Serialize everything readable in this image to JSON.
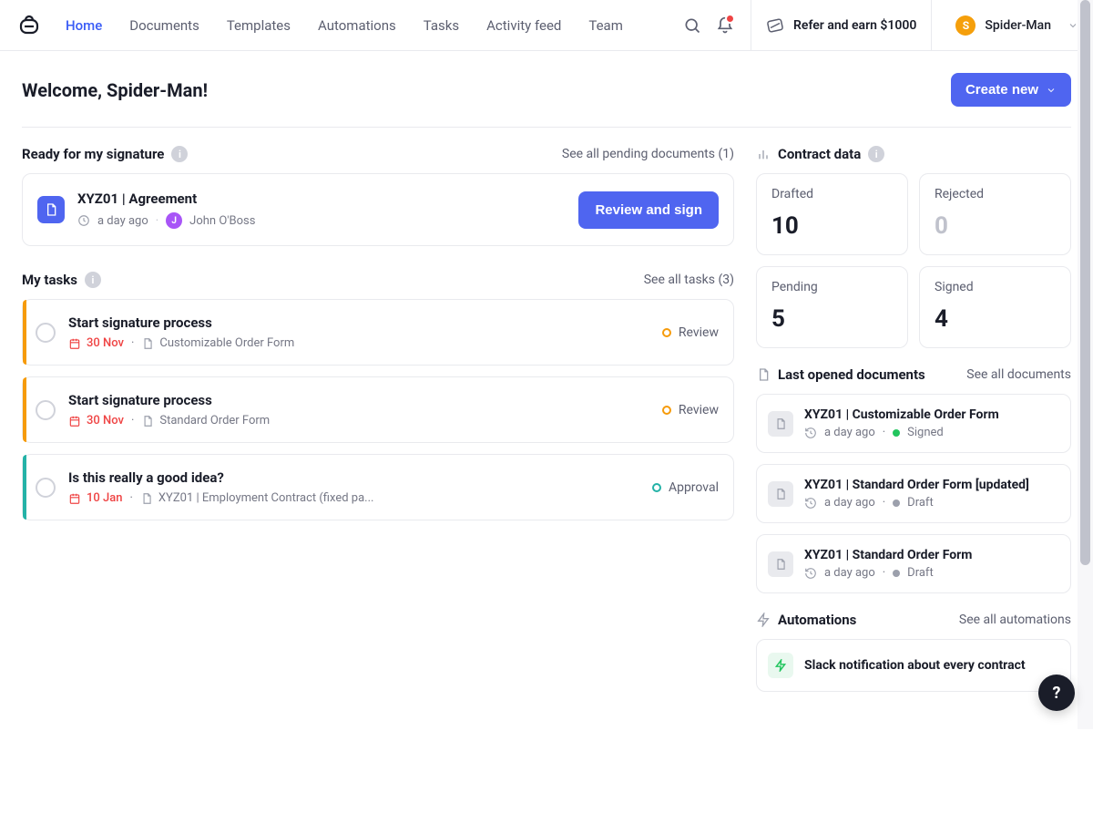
{
  "nav": {
    "items": [
      "Home",
      "Documents",
      "Templates",
      "Automations",
      "Tasks",
      "Activity feed",
      "Team"
    ],
    "active_index": 0,
    "refer_label": "Refer and earn $1000",
    "user_name": "Spider-Man",
    "user_initial": "S"
  },
  "header": {
    "welcome": "Welcome, Spider-Man!",
    "create_label": "Create new"
  },
  "signature": {
    "section_label": "Ready for my signature",
    "see_all_label": "See all pending documents (1)",
    "item": {
      "title": "XYZ01 | Agreement",
      "time_ago": "a day ago",
      "author": "John O'Boss",
      "author_initial": "J",
      "review_btn": "Review and sign"
    }
  },
  "tasks": {
    "section_label": "My tasks",
    "see_all_label": "See all tasks (3)",
    "items": [
      {
        "title": "Start signature process",
        "date": "30 Nov",
        "doc": "Customizable Order Form",
        "status": "Review",
        "accent": "warn"
      },
      {
        "title": "Start signature process",
        "date": "30 Nov",
        "doc": "Standard Order Form",
        "status": "Review",
        "accent": "warn"
      },
      {
        "title": "Is this really a good idea?",
        "date": "10 Jan",
        "doc": "XYZ01 | Employment Contract (fixed pa...",
        "status": "Approval",
        "accent": "teal"
      }
    ]
  },
  "contract": {
    "section_label": "Contract data",
    "stats": [
      {
        "label": "Drafted",
        "value": "10",
        "muted": false
      },
      {
        "label": "Rejected",
        "value": "0",
        "muted": true
      },
      {
        "label": "Pending",
        "value": "5",
        "muted": false
      },
      {
        "label": "Signed",
        "value": "4",
        "muted": false
      }
    ]
  },
  "last_opened": {
    "section_label": "Last opened documents",
    "see_all_label": "See all documents",
    "items": [
      {
        "title": "XYZ01 | Customizable Order Form",
        "time": "a day ago",
        "state": "Signed",
        "dot": "green"
      },
      {
        "title": "XYZ01 | Standard Order Form [updated]",
        "time": "a day ago",
        "state": "Draft",
        "dot": "gray"
      },
      {
        "title": "XYZ01 | Standard Order Form",
        "time": "a day ago",
        "state": "Draft",
        "dot": "gray"
      }
    ]
  },
  "automations": {
    "section_label": "Automations",
    "see_all_label": "See all automations",
    "item_title": "Slack notification about every contract"
  },
  "help_label": "?"
}
